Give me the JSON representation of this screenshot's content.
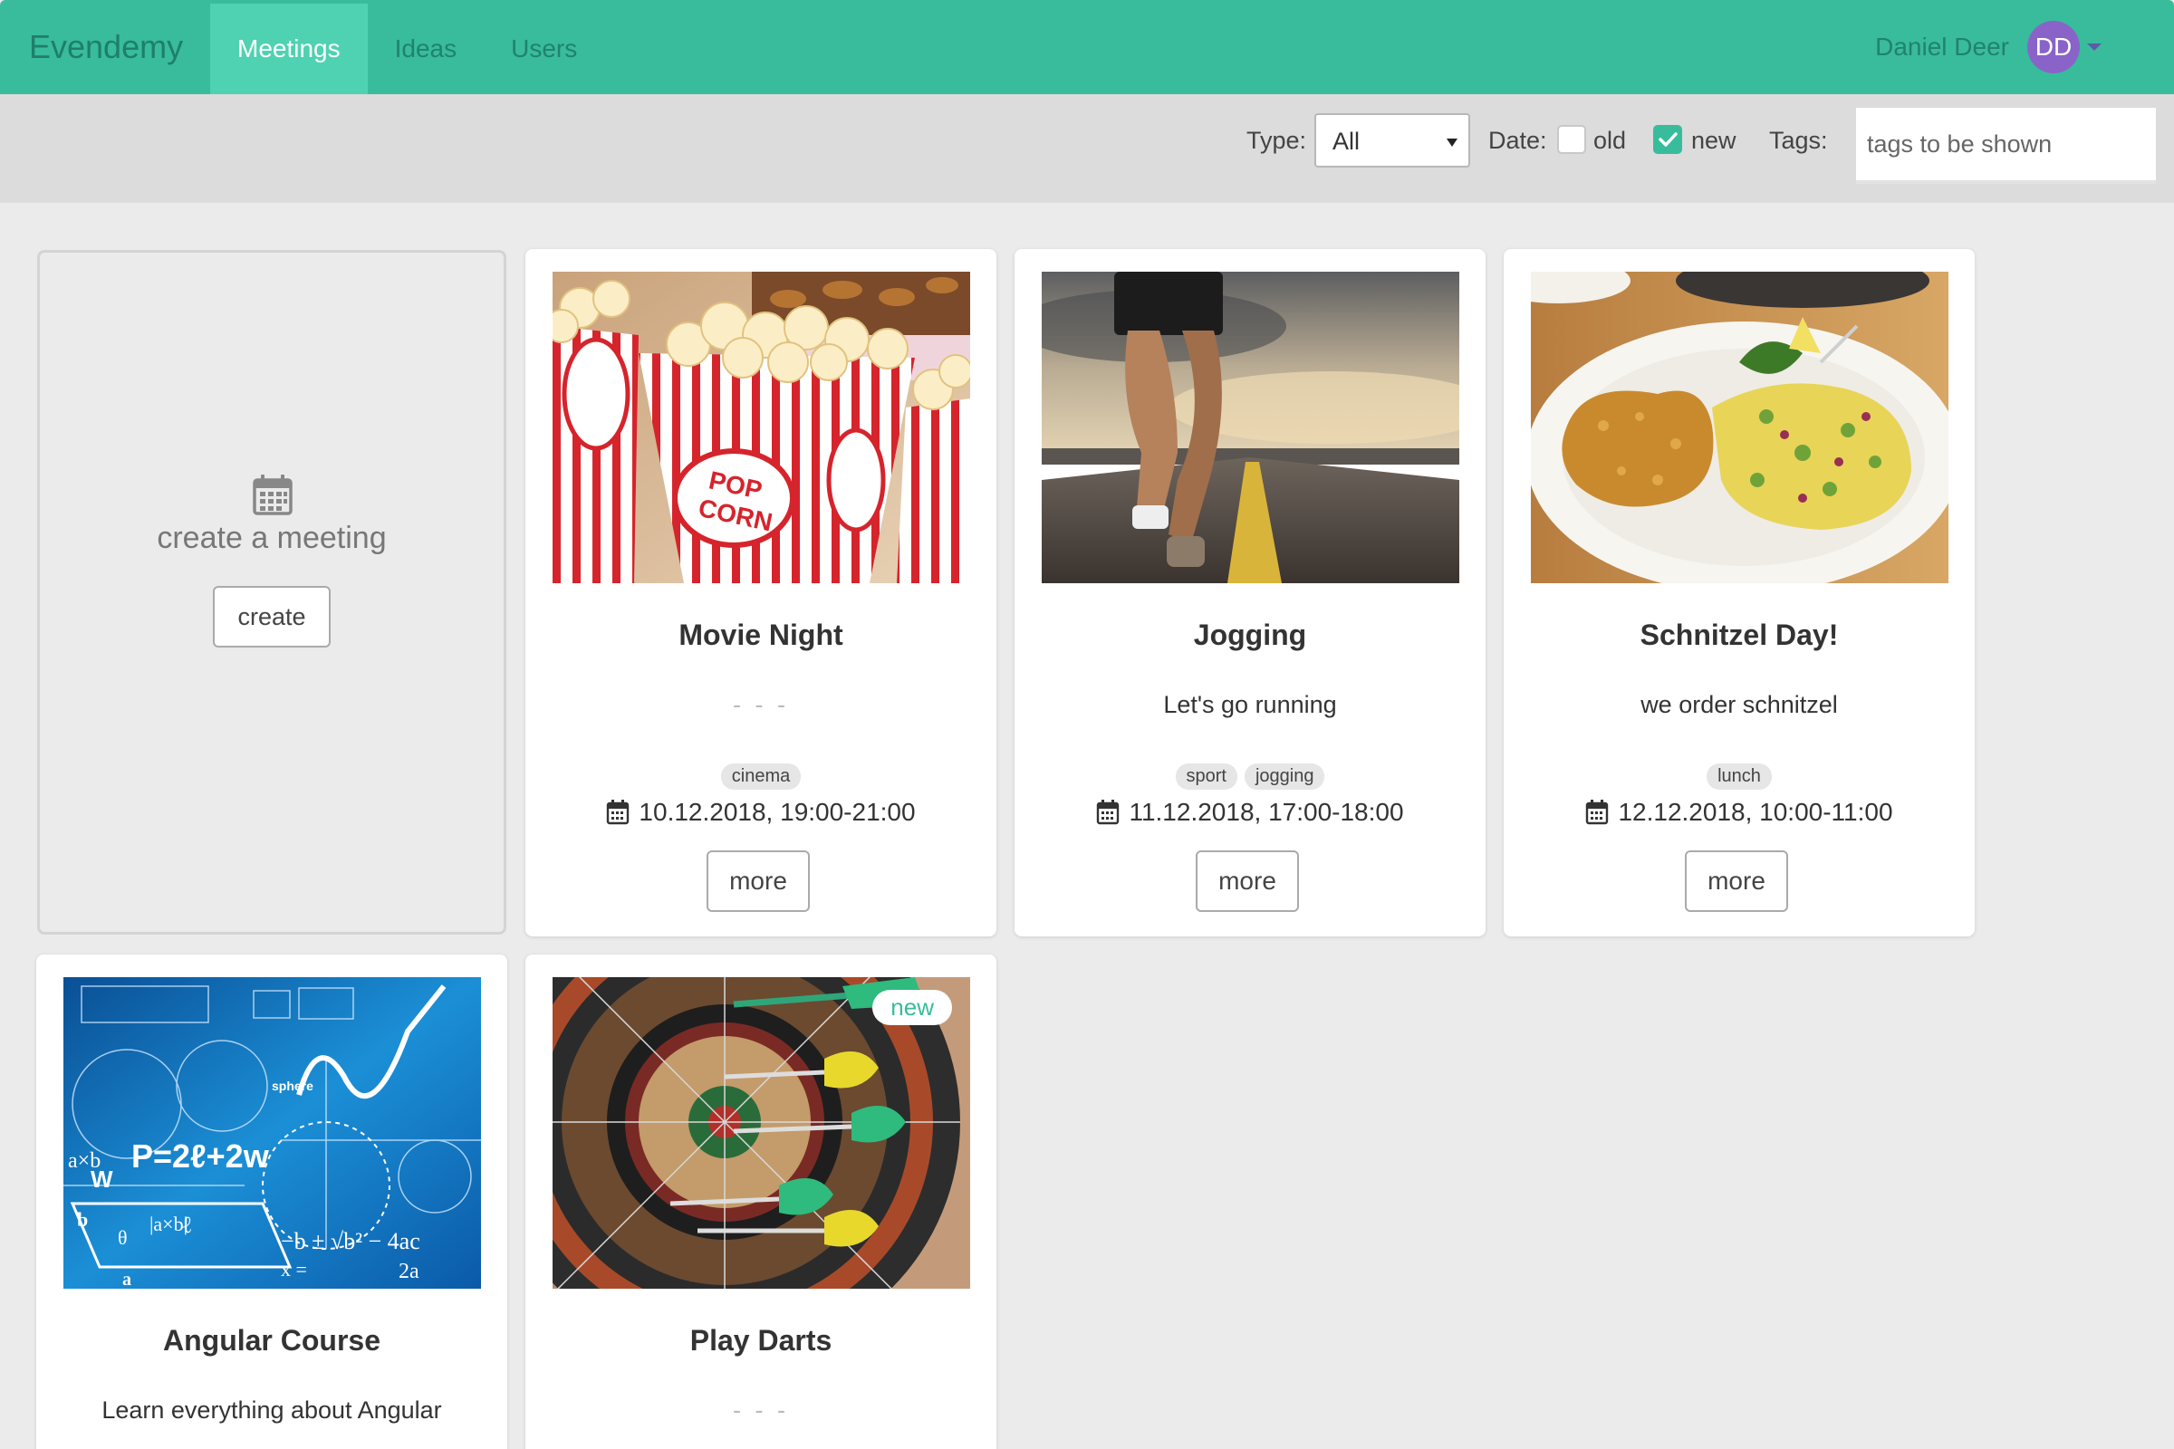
{
  "app": {
    "brand": "Evendemy",
    "nav": [
      {
        "label": "Meetings",
        "active": true
      },
      {
        "label": "Ideas",
        "active": false
      },
      {
        "label": "Users",
        "active": false
      }
    ],
    "user": {
      "name": "Daniel Deer",
      "initials": "DD"
    }
  },
  "filters": {
    "type_label": "Type:",
    "type_value": "All",
    "date_label": "Date:",
    "old_label": "old",
    "old_checked": false,
    "new_label": "new",
    "new_checked": true,
    "tags_label": "Tags:",
    "tags_placeholder": "tags to be shown"
  },
  "create_card": {
    "text": "create a meeting",
    "button": "create"
  },
  "meetings": [
    {
      "title": "Movie Night",
      "description": "- - -",
      "tags": [
        "cinema"
      ],
      "date": "10.12.2018, 19:00-21:00",
      "more": "more",
      "image": "popcorn"
    },
    {
      "title": "Jogging",
      "description": "Let's go running",
      "tags": [
        "sport",
        "jogging"
      ],
      "date": "11.12.2018, 17:00-18:00",
      "more": "more",
      "image": "runner-on-road"
    },
    {
      "title": "Schnitzel Day!",
      "description": "we order schnitzel",
      "tags": [
        "lunch"
      ],
      "date": "12.12.2018, 10:00-11:00",
      "more": "more",
      "image": "schnitzel-plate"
    },
    {
      "title": "Angular Course",
      "description": "Learn everything about Angular",
      "image": "math-formulas",
      "image_text": [
        "P=2ℓ+2w",
        "a×b",
        "|a×b|",
        "−b ± √b² − 4ac",
        "2a",
        "θ",
        "x =",
        "W",
        "ℓ",
        "a",
        "b",
        "sphere"
      ]
    },
    {
      "title": "Play Darts",
      "description": "- - -",
      "badge": "new",
      "image": "darts-board"
    }
  ],
  "colors": {
    "navbar": "#38bc9c",
    "nav_active": "#4fd2b1",
    "avatar": "#8a63c9",
    "page_bg": "#ebebeb"
  },
  "icons": {
    "date": "calendar-icon",
    "create": "calendar-icon",
    "dropdown": "caret-down-icon",
    "checked": "checkmark-icon"
  }
}
